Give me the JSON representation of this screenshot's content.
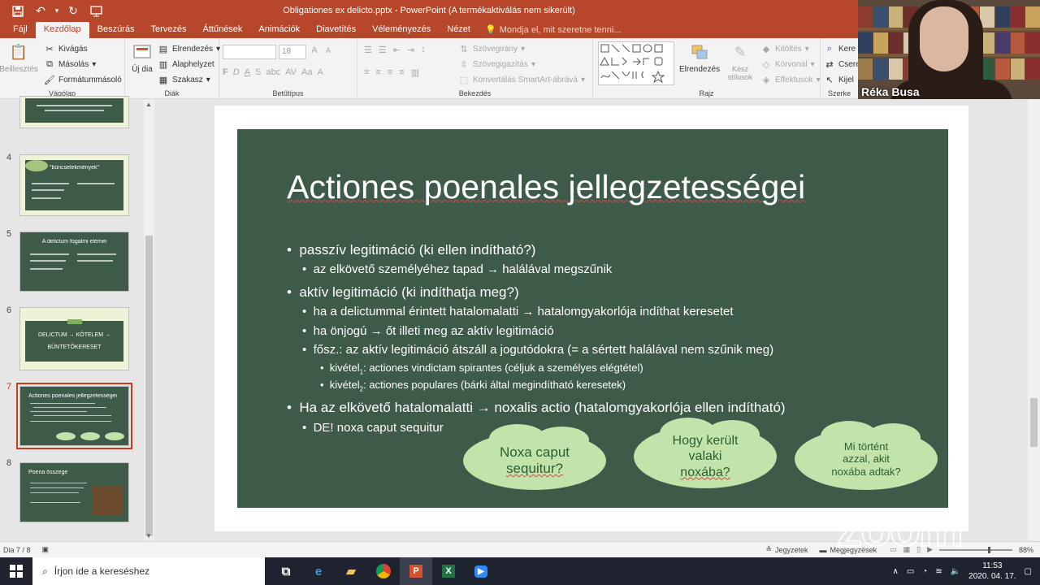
{
  "titlebar": {
    "title": "Obligationes ex delicto.pptx  -  PowerPoint (A termékaktiválás nem sikerült)",
    "save_icon": "save-icon",
    "undo_icon": "undo-icon",
    "redo_icon": "redo-icon",
    "present_icon": "start-presentation-icon"
  },
  "tabs": [
    "Fájl",
    "Kezdőlap",
    "Beszúrás",
    "Tervezés",
    "Áttűnések",
    "Animációk",
    "Diavetítés",
    "Véleményezés",
    "Nézet"
  ],
  "active_tab_index": 1,
  "tellme": "Mondja el, mit szeretne tenni...",
  "ribbon": {
    "clipboard": {
      "paste": "Beillesztés",
      "cut": "Kivágás",
      "copy": "Másolás",
      "format": "Formátummásoló",
      "label": "Vágólap"
    },
    "slides": {
      "new": "Új dia",
      "layout": "Elrendezés",
      "reset": "Alaphelyzet",
      "section": "Szakasz",
      "label": "Diák"
    },
    "font": {
      "font_size": "18",
      "label": "Betűtípus",
      "b": "F",
      "i": "D",
      "u": "A",
      "s": "S"
    },
    "paragraph": {
      "direction": "Szövegirány",
      "align": "Szövegigazítás",
      "smartart": "Konvertálás SmartArt-ábrává",
      "label": "Bekezdés"
    },
    "drawing": {
      "arrange": "Elrendezés",
      "styles": "Kész stílusok",
      "fill": "Kitöltés",
      "outline": "Körvonal",
      "effects": "Effektusok",
      "label": "Rajz"
    },
    "editing": {
      "find": "Kere",
      "replace": "Csere",
      "select": "Kijel",
      "label": "Szerke"
    }
  },
  "webcam": {
    "name": "Réka Busa"
  },
  "thumbnails": [
    {
      "num": "",
      "title": ""
    },
    {
      "num": "4",
      "title": "\"bűncselekmények\""
    },
    {
      "num": "5",
      "title": "A delictum fogalmi elemei"
    },
    {
      "num": "6",
      "title": "DELICTUM → KÖTELEM → BÜNTETŐKERESET"
    },
    {
      "num": "7",
      "title": "Actiones poenales jellegzetességei"
    },
    {
      "num": "8",
      "title": "Poena összege"
    }
  ],
  "slide": {
    "title": "Actiones poenales jellegzetességei",
    "lines": [
      {
        "level": 1,
        "text": "passzív legitimáció (ki ellen indítható?)"
      },
      {
        "level": 2,
        "text": "az elkövető személyéhez tapad → halálával megszűnik"
      },
      {
        "level": 1,
        "text": "aktív legitimáció (ki indíthatja meg?)"
      },
      {
        "level": 2,
        "text": "ha a delictummal érintett hatalomalatti → hatalomgyakorlója indíthat keresetet"
      },
      {
        "level": 2,
        "text": "ha önjogú → őt illeti meg az aktív legitimáció"
      },
      {
        "level": 2,
        "text": "fősz.: az aktív legitimáció átszáll a jogutódokra (= a sértett halálával nem szűnik meg)"
      },
      {
        "level": 3,
        "pre": "kivétel",
        "sub": "1",
        "text": ": actiones vindictam spirantes (céljuk a személyes elégtétel)"
      },
      {
        "level": 3,
        "pre": "kivétel",
        "sub": "2",
        "text": ": actiones populares (bárki által megindítható keresetek)"
      },
      {
        "level": 1,
        "text": "Ha az elkövető hatalomalatti → noxalis actio (hatalomgyakorlója ellen indítható)"
      },
      {
        "level": 2,
        "text": "DE! noxa caput sequitur"
      }
    ],
    "clouds": [
      {
        "line1": "Noxa caput",
        "line2": "sequitur?",
        "line3": ""
      },
      {
        "line1": "Hogy került",
        "line2": "valaki",
        "line3": "noxába?"
      },
      {
        "line1": "Mi történt",
        "line2": "azzal, akit",
        "line3": "noxába adtak?"
      }
    ]
  },
  "status": {
    "slide": "Dia 7 / 8",
    "notes": "Jegyzetek",
    "comments": "Megjegyzések",
    "zoom": "88%"
  },
  "taskbar": {
    "search_placeholder": "Írjon ide a kereséshez",
    "time": "11:53",
    "date": "2020. 04. 17."
  }
}
